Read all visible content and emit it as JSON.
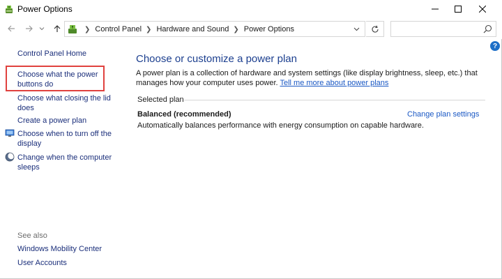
{
  "window": {
    "title": "Power Options"
  },
  "address": {
    "crumbs": [
      "Control Panel",
      "Hardware and Sound",
      "Power Options"
    ],
    "search_placeholder": ""
  },
  "help": {
    "label": "?"
  },
  "left_pane": {
    "home": "Control Panel Home",
    "items": [
      "Choose what the power buttons do",
      "Choose what closing the lid does",
      "Create a power plan",
      "Choose when to turn off the display",
      "Change when the computer sleeps"
    ],
    "see_also_label": "See also",
    "see_also": [
      "Windows Mobility Center",
      "User Accounts"
    ],
    "highlight_color": "#e0413e"
  },
  "main": {
    "title": "Choose or customize a power plan",
    "description": "A power plan is a collection of hardware and system settings (like display brightness, sleep, etc.) that manages how your computer uses power.",
    "description_link": "Tell me more about power plans",
    "selected_plan_label": "Selected plan",
    "plan": {
      "name": "Balanced (recommended)",
      "description": "Automatically balances performance with energy consumption on capable hardware.",
      "change_link": "Change plan settings"
    }
  },
  "colors": {
    "title_blue": "#1c3f8f",
    "link_blue": "#1a58c4",
    "nav_link": "#1a2e7a"
  },
  "icons": {
    "app": "power-options-icon",
    "back": "arrow-left-icon",
    "forward": "arrow-right-icon",
    "recent": "chevron-down-icon",
    "up": "arrow-up-icon",
    "address": "control-panel-icon",
    "refresh": "refresh-icon",
    "search": "search-icon",
    "display": "monitor-icon",
    "sleep": "moon-icon"
  }
}
